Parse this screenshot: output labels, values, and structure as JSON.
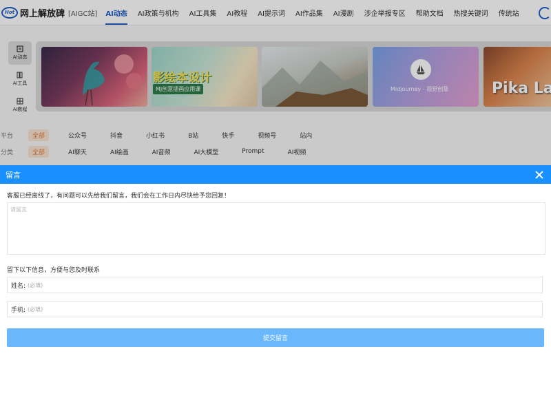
{
  "header": {
    "logo_badge": "Hot",
    "site_name": "网上解放碑",
    "site_sub": "[AIGC站]",
    "nav": [
      "AI动态",
      "AI政策与机构",
      "AI工具集",
      "AI教程",
      "AI提示词",
      "AI作品集",
      "AI漫剧",
      "涉企举报专区",
      "帮助文档",
      "热搜关键词",
      "传统站"
    ],
    "active_nav": 0
  },
  "side_tabs": [
    {
      "label": "AI动态",
      "icon": "news-icon",
      "active": true
    },
    {
      "label": "AI工具",
      "icon": "book-icon",
      "active": false
    },
    {
      "label": "AI教程",
      "icon": "grid-icon",
      "active": false
    }
  ],
  "banners": [
    {
      "title": "",
      "subtitle": ""
    },
    {
      "title": "影绘本设计",
      "subtitle": "MJ创意插画应用课"
    },
    {
      "title": "",
      "subtitle": ""
    },
    {
      "title": "",
      "subtitle": "Midjourney - 视觉创意"
    },
    {
      "title": "Pika La",
      "subtitle": ""
    }
  ],
  "filters": {
    "platform_label": "平台",
    "platform_options": [
      "全部",
      "公众号",
      "抖音",
      "小红书",
      "B站",
      "快手",
      "视频号",
      "站内"
    ],
    "category_label": "分类",
    "category_options": [
      "全部",
      "AI聊天",
      "AI绘画",
      "AI音频",
      "AI大模型",
      "Prompt",
      "AI视频"
    ]
  },
  "modal": {
    "title": "留言",
    "notice": "客服已经离线了，有问题可以先给我们留言，我们会在工作日内尽快给予您回复！",
    "message_placeholder": "请留言",
    "info_label": "留下以下信息，方便与您及时联系",
    "name_label": "姓名:",
    "name_placeholder": "(必填)",
    "phone_label": "手机:",
    "phone_placeholder": "(必填)",
    "submit_label": "提交留言"
  },
  "colors": {
    "brand": "#1e5fc9",
    "modal_header": "#1890ff",
    "submit": "#6ab8fb",
    "chip_active": "#e67f3f"
  }
}
